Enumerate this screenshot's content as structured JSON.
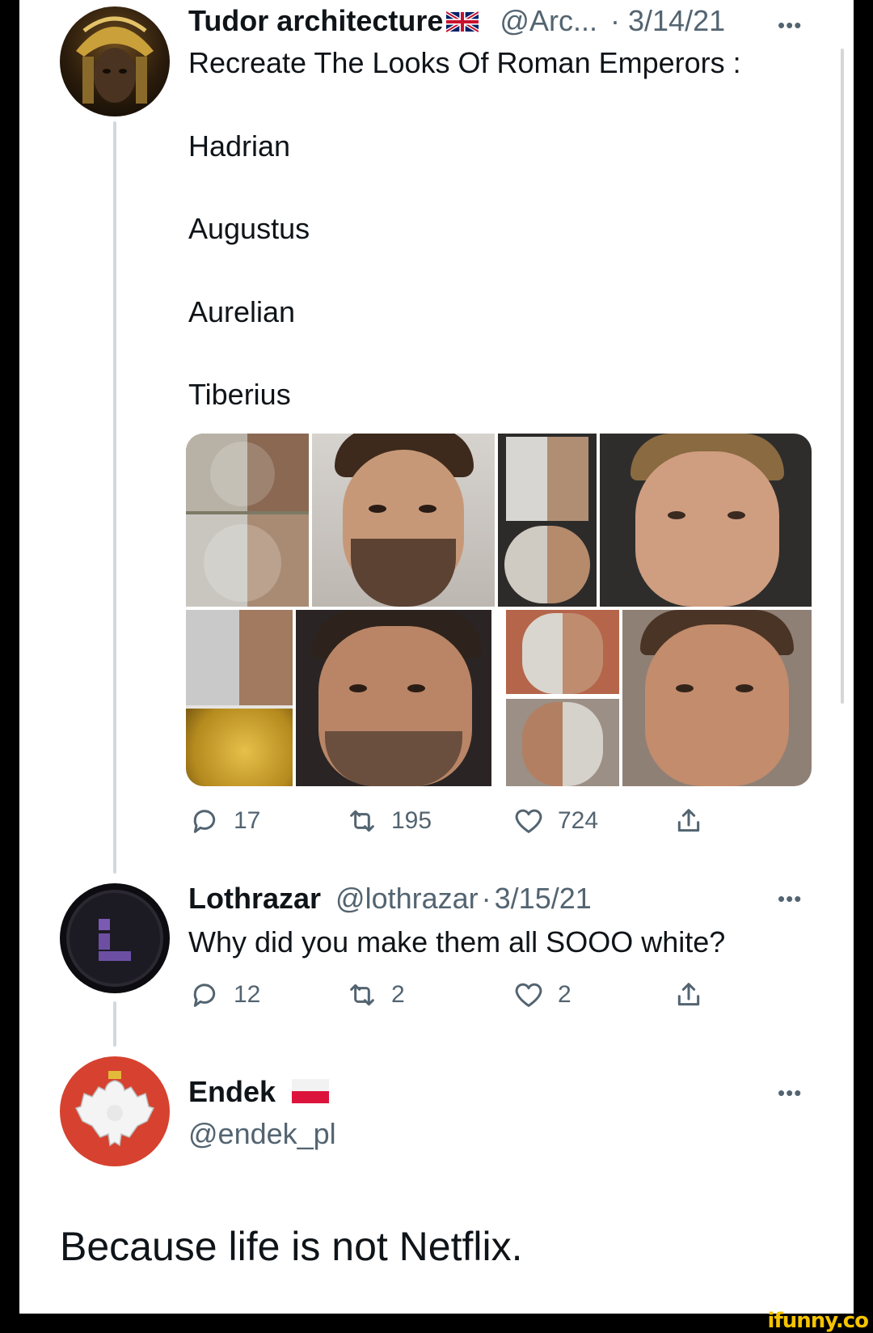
{
  "tweet1": {
    "author_name": "Tudor architecture",
    "flag_icon": "uk-flag-icon",
    "handle": "@Arc...",
    "separator": "·",
    "date": "3/14/21",
    "text": "Recreate The Looks Of Roman Emperors :",
    "emperors": [
      "Hadrian",
      "Augustus",
      "Aurelian",
      "Tiberius"
    ],
    "actions": {
      "replies": "17",
      "retweets": "195",
      "likes": "724"
    },
    "media": [
      {
        "name": "hadrian-statue-split"
      },
      {
        "name": "hadrian-reconstruction"
      },
      {
        "name": "augustus-statue-split"
      },
      {
        "name": "augustus-reconstruction"
      },
      {
        "name": "aurelian-statue-split"
      },
      {
        "name": "aurelian-reconstruction"
      },
      {
        "name": "tiberius-statue-split"
      },
      {
        "name": "tiberius-reconstruction"
      }
    ]
  },
  "tweet2": {
    "author_name": "Lothrazar",
    "handle": "@lothrazar",
    "separator": "·",
    "date": "3/15/21",
    "text": "Why did you make them all SOOO white?",
    "actions": {
      "replies": "12",
      "retweets": "2",
      "likes": "2"
    }
  },
  "tweet3": {
    "author_name": "Endek",
    "flag_icon": "poland-flag-icon",
    "handle": "@endek_pl",
    "text": "Because life is not Netflix."
  },
  "more_glyph": "•••",
  "watermark": "ifunny.co",
  "colors": {
    "text": "#0f1419",
    "muted": "#536471",
    "thread_line": "#cfd9de",
    "watermark": "#f5c400"
  }
}
